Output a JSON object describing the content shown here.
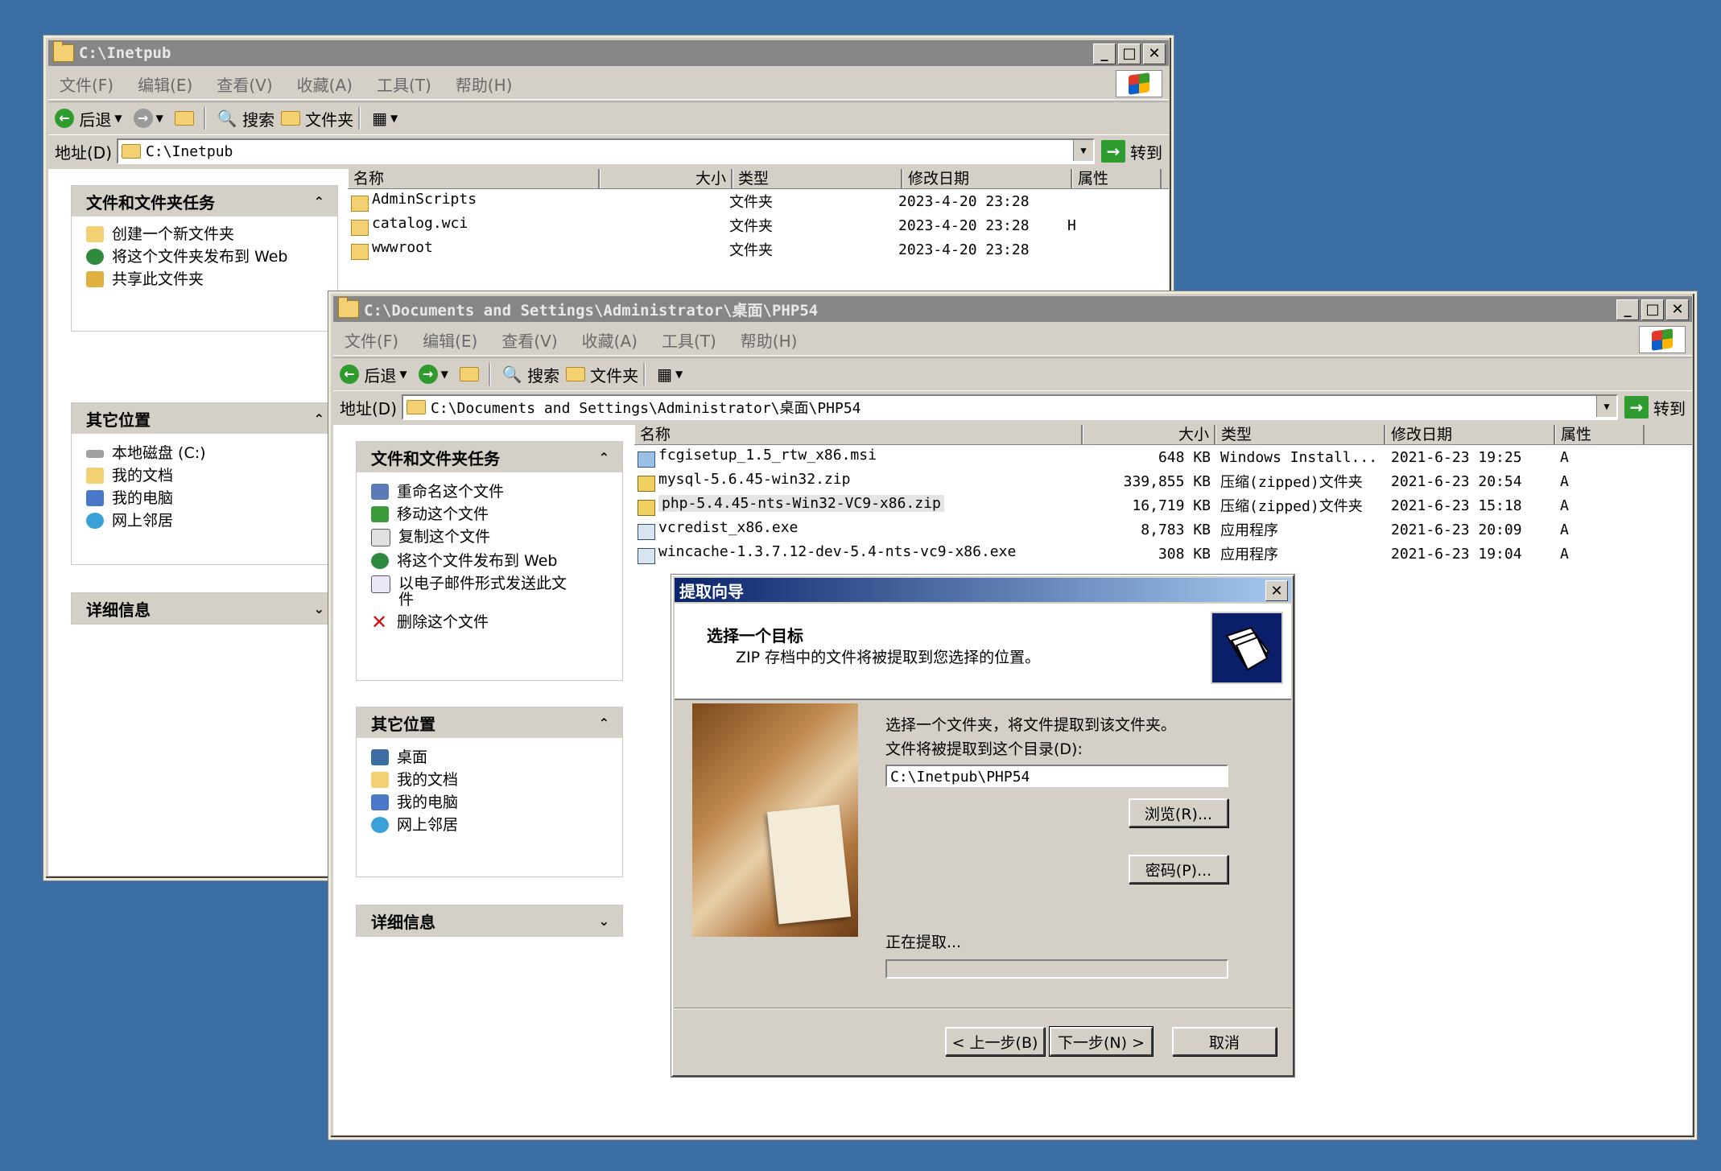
{
  "menu": [
    "文件(F)",
    "编辑(E)",
    "查看(V)",
    "收藏(A)",
    "工具(T)",
    "帮助(H)"
  ],
  "toolbar": {
    "back": "后退",
    "search": "搜索",
    "folders": "文件夹",
    "address_label": "地址(D)",
    "go": "转到"
  },
  "window_back": {
    "title": "C:\\Inetpub",
    "address": "C:\\Inetpub",
    "tasks_title": "文件和文件夹任务",
    "tasks": [
      "创建一个新文件夹",
      "将这个文件夹发布到 Web",
      "共享此文件夹"
    ],
    "places_title": "其它位置",
    "places": [
      "本地磁盘 (C:)",
      "我的文档",
      "我的电脑",
      "网上邻居"
    ],
    "details_title": "详细信息",
    "columns": [
      "名称",
      "大小",
      "类型",
      "修改日期",
      "属性"
    ],
    "files": [
      {
        "name": "AdminScripts",
        "size": "",
        "type": "文件夹",
        "date": "2023-4-20 23:28",
        "attr": ""
      },
      {
        "name": "catalog.wci",
        "size": "",
        "type": "文件夹",
        "date": "2023-4-20 23:28",
        "attr": "H"
      },
      {
        "name": "wwwroot",
        "size": "",
        "type": "文件夹",
        "date": "2023-4-20 23:28",
        "attr": ""
      }
    ]
  },
  "window_front": {
    "title": "C:\\Documents and Settings\\Administrator\\桌面\\PHP54",
    "address": "C:\\Documents and Settings\\Administrator\\桌面\\PHP54",
    "tasks_title": "文件和文件夹任务",
    "tasks": [
      "重命名这个文件",
      "移动这个文件",
      "复制这个文件",
      "将这个文件发布到 Web",
      "以电子邮件形式发送此文件",
      "删除这个文件"
    ],
    "places_title": "其它位置",
    "places": [
      "桌面",
      "我的文档",
      "我的电脑",
      "网上邻居"
    ],
    "details_title": "详细信息",
    "columns": [
      "名称",
      "大小",
      "类型",
      "修改日期",
      "属性"
    ],
    "files": [
      {
        "name": "fcgisetup_1.5_rtw_x86.msi",
        "size": "648 KB",
        "type": "Windows Install...",
        "date": "2021-6-23 19:25",
        "attr": "A"
      },
      {
        "name": "mysql-5.6.45-win32.zip",
        "size": "339,855 KB",
        "type": "压缩(zipped)文件夹",
        "date": "2021-6-23 20:54",
        "attr": "A"
      },
      {
        "name": "php-5.4.45-nts-Win32-VC9-x86.zip",
        "size": "16,719 KB",
        "type": "压缩(zipped)文件夹",
        "date": "2021-6-23 15:18",
        "attr": "A"
      },
      {
        "name": "vcredist_x86.exe",
        "size": "8,783 KB",
        "type": "应用程序",
        "date": "2021-6-23 20:09",
        "attr": "A"
      },
      {
        "name": "wincache-1.3.7.12-dev-5.4-nts-vc9-x86.exe",
        "size": "308 KB",
        "type": "应用程序",
        "date": "2021-6-23 19:04",
        "attr": "A"
      }
    ]
  },
  "dialog": {
    "title": "提取向导",
    "heading": "选择一个目标",
    "subheading": "ZIP 存档中的文件将被提取到您选择的位置。",
    "instruction": "选择一个文件夹，将文件提取到该文件夹。",
    "dest_label": "文件将被提取到这个目录(D):",
    "dest_value": "C:\\Inetpub\\PHP54",
    "browse": "浏览(R)...",
    "password": "密码(P)...",
    "status": "正在提取...",
    "progress": 0,
    "back": "< 上一步(B)",
    "next": "下一步(N) >",
    "cancel": "取消"
  }
}
